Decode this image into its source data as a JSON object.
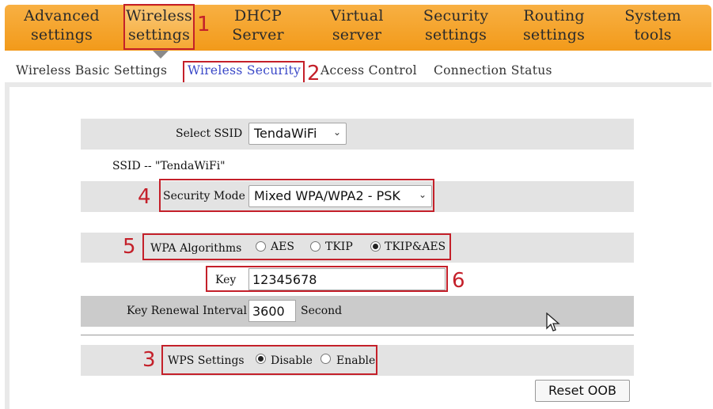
{
  "nav": {
    "items": [
      {
        "line1": "Advanced",
        "line2": "settings"
      },
      {
        "line1": "Wireless",
        "line2": "settings"
      },
      {
        "line1": "DHCP",
        "line2": "Server"
      },
      {
        "line1": "Virtual",
        "line2": "server"
      },
      {
        "line1": "Security",
        "line2": "settings"
      },
      {
        "line1": "Routing",
        "line2": "settings"
      },
      {
        "line1": "System",
        "line2": "tools"
      }
    ],
    "active_index": 1
  },
  "subnav": {
    "items": [
      "Wireless Basic Settings",
      "Wireless Security",
      "Access Control",
      "Connection Status"
    ],
    "active": "Wireless Security"
  },
  "form": {
    "select_ssid_label": "Select SSID",
    "select_ssid_value": "TendaWiFi",
    "ssid_info": "SSID -- \"TendaWiFi\"",
    "security_mode_label": "Security Mode",
    "security_mode_value": "Mixed WPA/WPA2 - PSK",
    "wpa_algorithms_label": "WPA Algorithms",
    "wpa_algorithms_options": [
      "AES",
      "TKIP",
      "TKIP&AES"
    ],
    "wpa_algorithms_selected": "TKIP&AES",
    "key_label": "Key",
    "key_value": "12345678",
    "key_renewal_label": "Key Renewal Interval",
    "key_renewal_value": "3600",
    "key_renewal_unit": "Second",
    "wps_label": "WPS Settings",
    "wps_options": [
      "Disable",
      "Enable"
    ],
    "wps_selected": "Disable",
    "reset_button": "Reset OOB"
  },
  "annotations": {
    "n1": "1",
    "n2": "2",
    "n3": "3",
    "n4": "4",
    "n5": "5",
    "n6": "6",
    "color": "#c4202a"
  },
  "icons": {
    "dropdown": "chevron-down-icon",
    "cursor": "mouse-pointer-icon"
  }
}
